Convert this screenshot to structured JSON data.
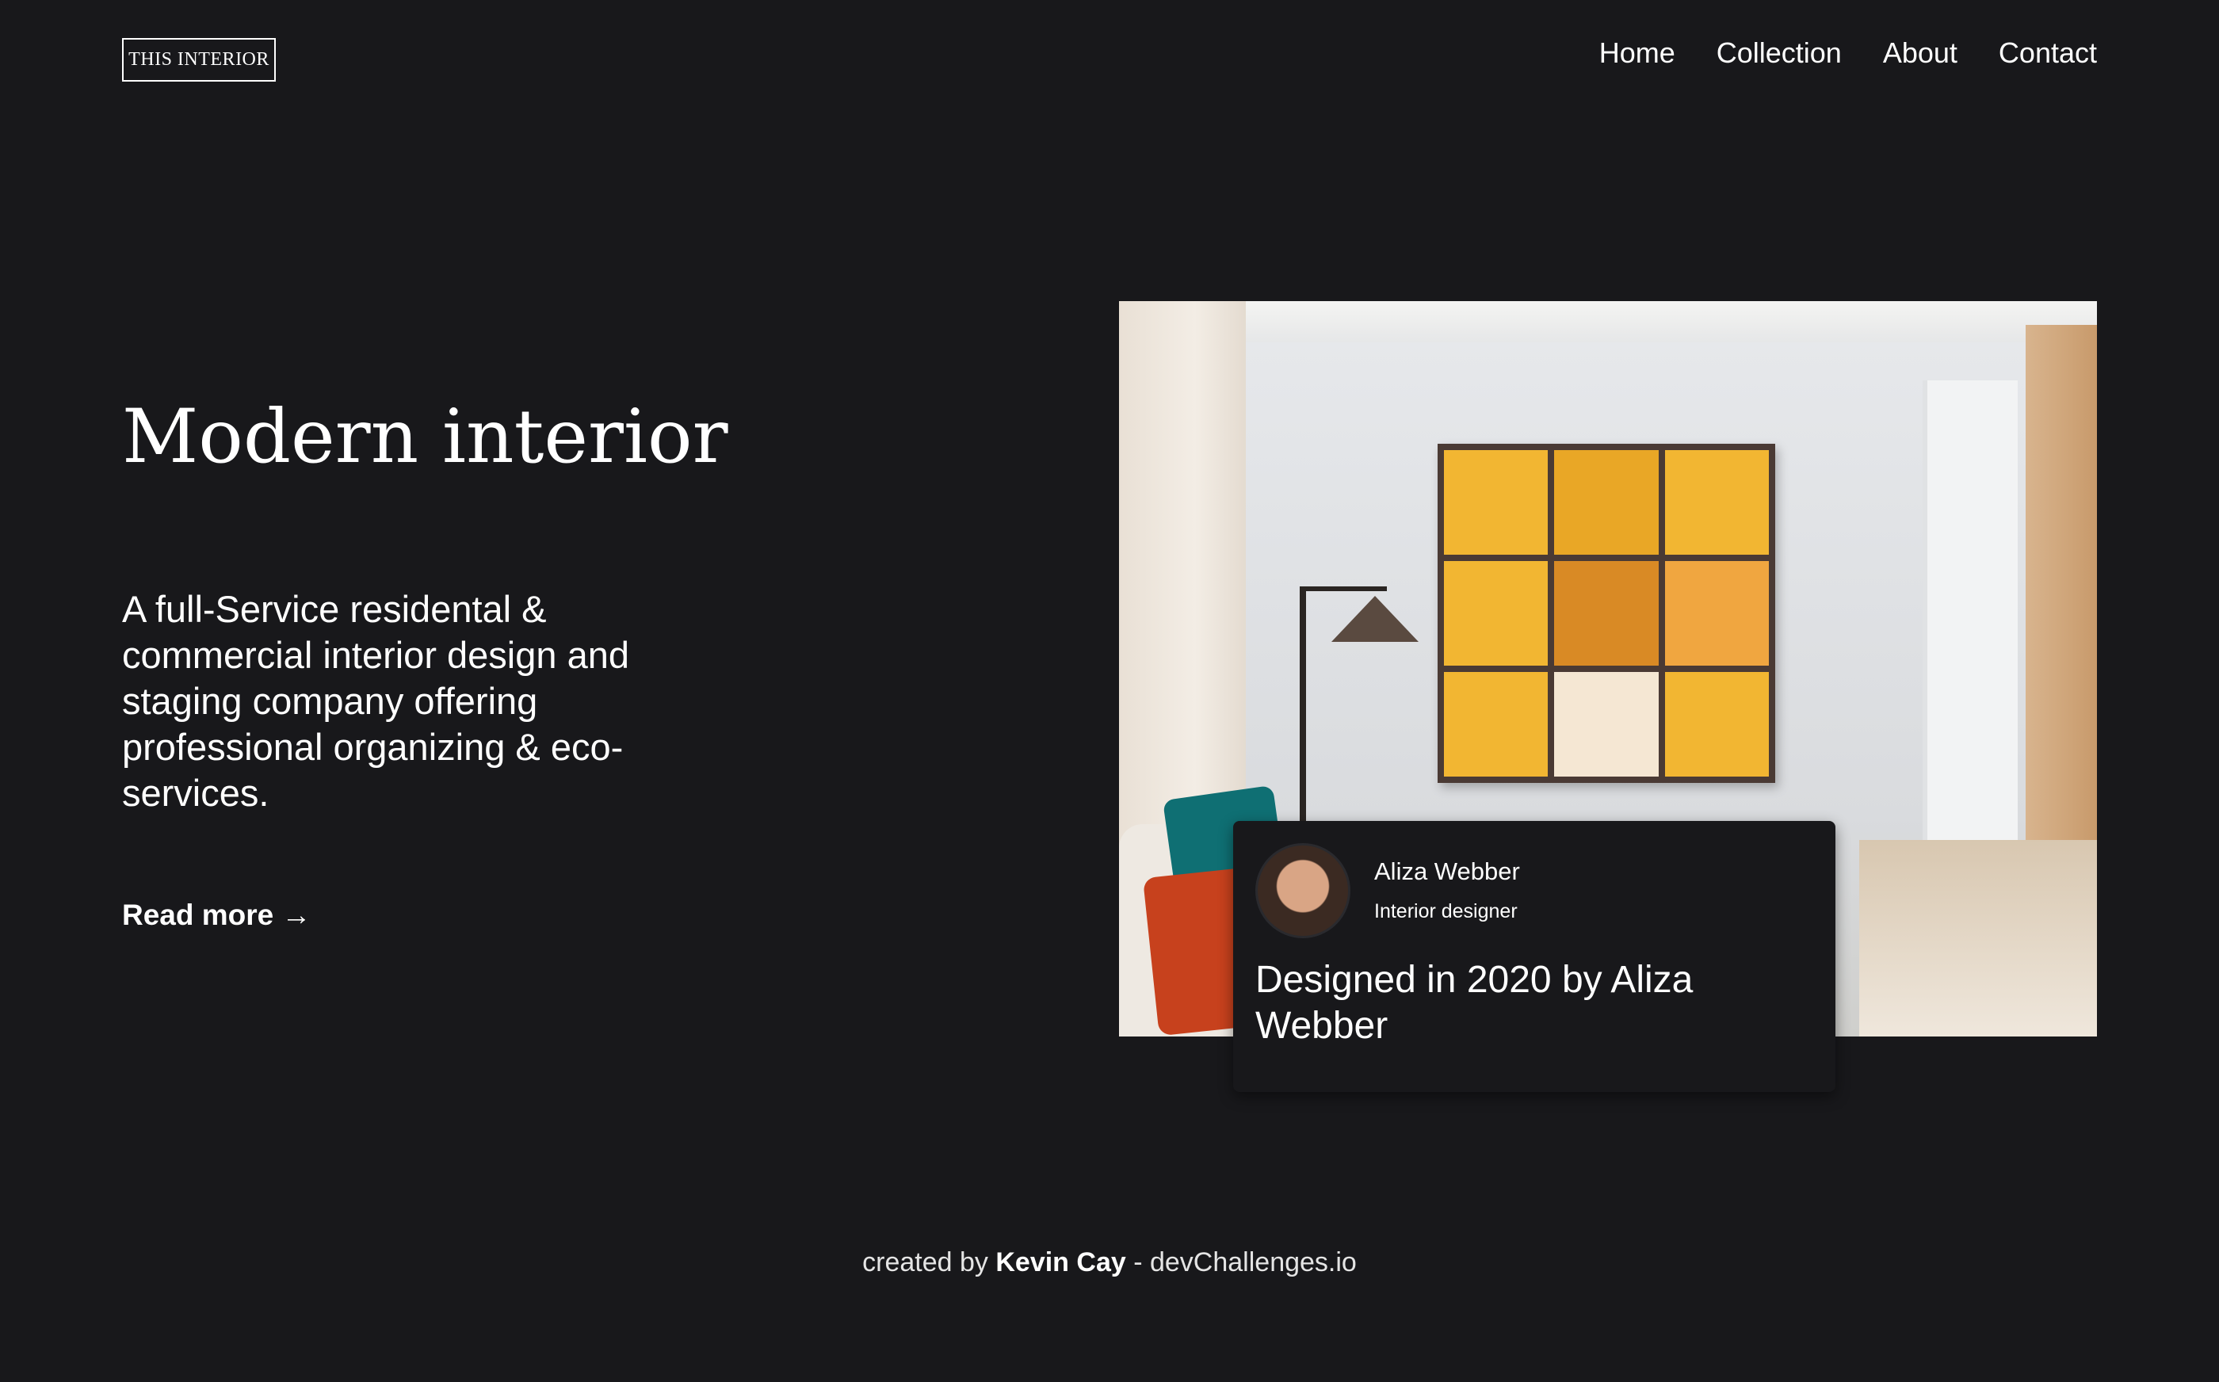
{
  "header": {
    "logo": "THIS INTERIOR",
    "nav": [
      "Home",
      "Collection",
      "About",
      "Contact"
    ]
  },
  "hero": {
    "title": "Modern interior",
    "description": "A full-Service residental & commercial interior design and staging company offering professional organizing & eco-services.",
    "read_more": "Read more →"
  },
  "card": {
    "name": "Aliza Webber",
    "role": "Interior designer",
    "caption": "Designed in 2020 by Aliza Webber"
  },
  "footer": {
    "prefix": "created by",
    "author": "Kevin Cay",
    "suffix": "- devChallenges.io"
  }
}
